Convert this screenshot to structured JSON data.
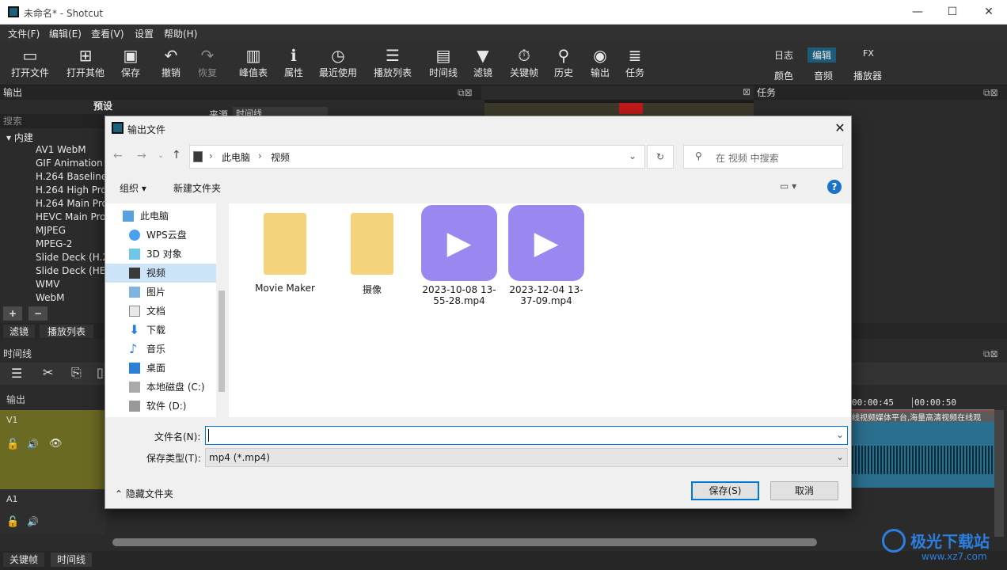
{
  "window": {
    "title": "未命名* - Shotcut",
    "controls": [
      "—",
      "☐",
      "✕"
    ]
  },
  "menu": [
    "文件(F)",
    "编辑(E)",
    "查看(V)",
    "设置",
    "帮助(H)"
  ],
  "toolbar": {
    "items": [
      {
        "label": "打开文件",
        "icon": "open-file-icon"
      },
      {
        "label": "打开其他",
        "icon": "open-other-icon"
      },
      {
        "label": "保存",
        "icon": "save-icon"
      },
      {
        "label": "撤销",
        "icon": "undo-icon"
      },
      {
        "label": "恢复",
        "icon": "redo-icon"
      },
      {
        "label": "峰值表",
        "icon": "peak-meter-icon"
      },
      {
        "label": "属性",
        "icon": "properties-icon"
      },
      {
        "label": "最近使用",
        "icon": "recent-icon"
      },
      {
        "label": "播放列表",
        "icon": "playlist-icon"
      },
      {
        "label": "时间线",
        "icon": "timeline-icon"
      },
      {
        "label": "滤镜",
        "icon": "filter-icon"
      },
      {
        "label": "关键帧",
        "icon": "keyframes-icon"
      },
      {
        "label": "历史",
        "icon": "history-icon"
      },
      {
        "label": "输出",
        "icon": "export-icon"
      },
      {
        "label": "任务",
        "icon": "jobs-icon"
      }
    ],
    "workspaces": {
      "row1": [
        "日志",
        "编辑",
        "FX"
      ],
      "row2": [
        "颜色",
        "音频",
        "播放器"
      ],
      "active": "编辑"
    }
  },
  "export_panel": {
    "title": "输出",
    "presets_heading": "预设",
    "search_placeholder": "搜索",
    "group": "内建",
    "presets": [
      "AV1 WebM",
      "GIF Animation",
      "H.264 Baseline",
      "H.264 High Pro",
      "H.264 Main Pro",
      "HEVC Main Pro",
      "MJPEG",
      "MPEG-2",
      "Slide Deck (H.2",
      "Slide Deck (HE",
      "WMV",
      "WebM"
    ],
    "source_label": "来源",
    "source_value": "时间线",
    "add": "+",
    "remove": "−"
  },
  "tabs_bottom_left": [
    "滤镜",
    "播放列表"
  ],
  "jobs_panel": {
    "title": "任务"
  },
  "timeline": {
    "title": "时间线",
    "output_label": "输出",
    "tracks": [
      "V1",
      "A1"
    ],
    "ruler": [
      "00:00:45",
      "00:00:50"
    ],
    "clip_text": "线视频媒体平台,海量高清视频在线观"
  },
  "bottom_tabs": [
    "关键帧",
    "时间线"
  ],
  "watermark": {
    "text": "极光下载站",
    "url": "www.xz7.com"
  },
  "dialog": {
    "title": "输出文件",
    "breadcrumb": [
      "此电脑",
      "视频"
    ],
    "search_placeholder": "在 视频 中搜索",
    "organize": "组织",
    "new_folder": "新建文件夹",
    "nav": [
      "此电脑",
      "WPS云盘",
      "3D 对象",
      "视频",
      "图片",
      "文档",
      "下载",
      "音乐",
      "桌面",
      "本地磁盘 (C:)",
      "软件 (D:)"
    ],
    "nav_selected": "视频",
    "files": [
      {
        "name": "Movie Maker",
        "kind": "folder"
      },
      {
        "name": "摄像",
        "kind": "folder"
      },
      {
        "name": "2023-10-08 13-55-28.mp4",
        "kind": "video"
      },
      {
        "name": "2023-12-04 13-37-09.mp4",
        "kind": "video"
      }
    ],
    "filename_label": "文件名(N):",
    "filename_value": "",
    "filetype_label": "保存类型(T):",
    "filetype_value": "mp4 (*.mp4)",
    "hide_folders": "隐藏文件夹",
    "save": "保存(S)",
    "cancel": "取消"
  }
}
